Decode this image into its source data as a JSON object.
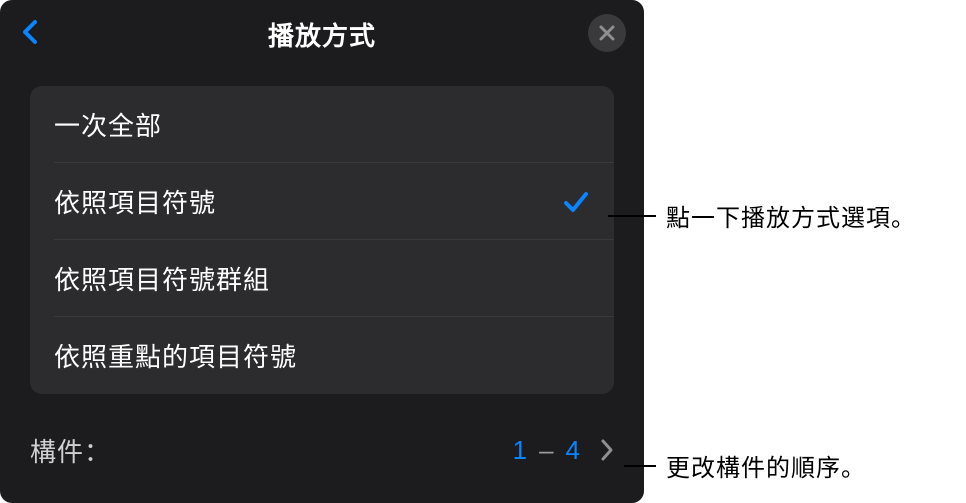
{
  "header": {
    "title": "播放方式"
  },
  "options": [
    {
      "label": "一次全部",
      "selected": false
    },
    {
      "label": "依照項目符號",
      "selected": true
    },
    {
      "label": "依照項目符號群組",
      "selected": false
    },
    {
      "label": "依照重點的項目符號",
      "selected": false
    }
  ],
  "builds": {
    "label": "構件：",
    "from": "1",
    "to": "4"
  },
  "callouts": {
    "option": "點一下播放方式選項。",
    "builds": "更改構件的順序。"
  },
  "colors": {
    "accent": "#0a84ff"
  }
}
